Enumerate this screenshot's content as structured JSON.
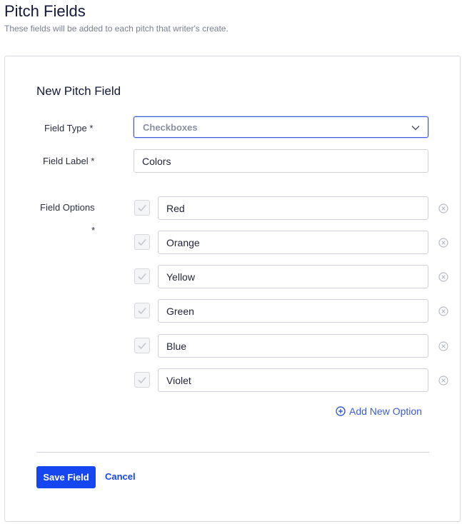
{
  "header": {
    "title": "Pitch Fields",
    "subtitle": "These fields will be added to each pitch that writer's create."
  },
  "form": {
    "section_title": "New Pitch Field",
    "field_type": {
      "label": "Field Type *",
      "value": "Checkboxes"
    },
    "field_label": {
      "label": "Field Label *",
      "value": "Colors"
    },
    "field_options": {
      "label": "Field Options",
      "required_marker": "*",
      "options": [
        {
          "value": "Red",
          "checked": true
        },
        {
          "value": "Orange",
          "checked": true
        },
        {
          "value": "Yellow",
          "checked": true
        },
        {
          "value": "Green",
          "checked": true
        },
        {
          "value": "Blue",
          "checked": true
        },
        {
          "value": "Violet",
          "checked": true
        }
      ],
      "add_option_label": "Add New Option"
    },
    "actions": {
      "save_label": "Save Field",
      "cancel_label": "Cancel"
    }
  },
  "icons": {
    "select_chevron": "chevron-down-icon",
    "option_checkbox": "check-icon",
    "remove_option": "remove-circle-icon",
    "add_option": "plus-circle-icon"
  },
  "colors": {
    "accent": "#1546f0",
    "link": "#3b5bdb",
    "title": "#14183a",
    "muted": "#7a7f8f",
    "border": "#cfd2d9"
  }
}
